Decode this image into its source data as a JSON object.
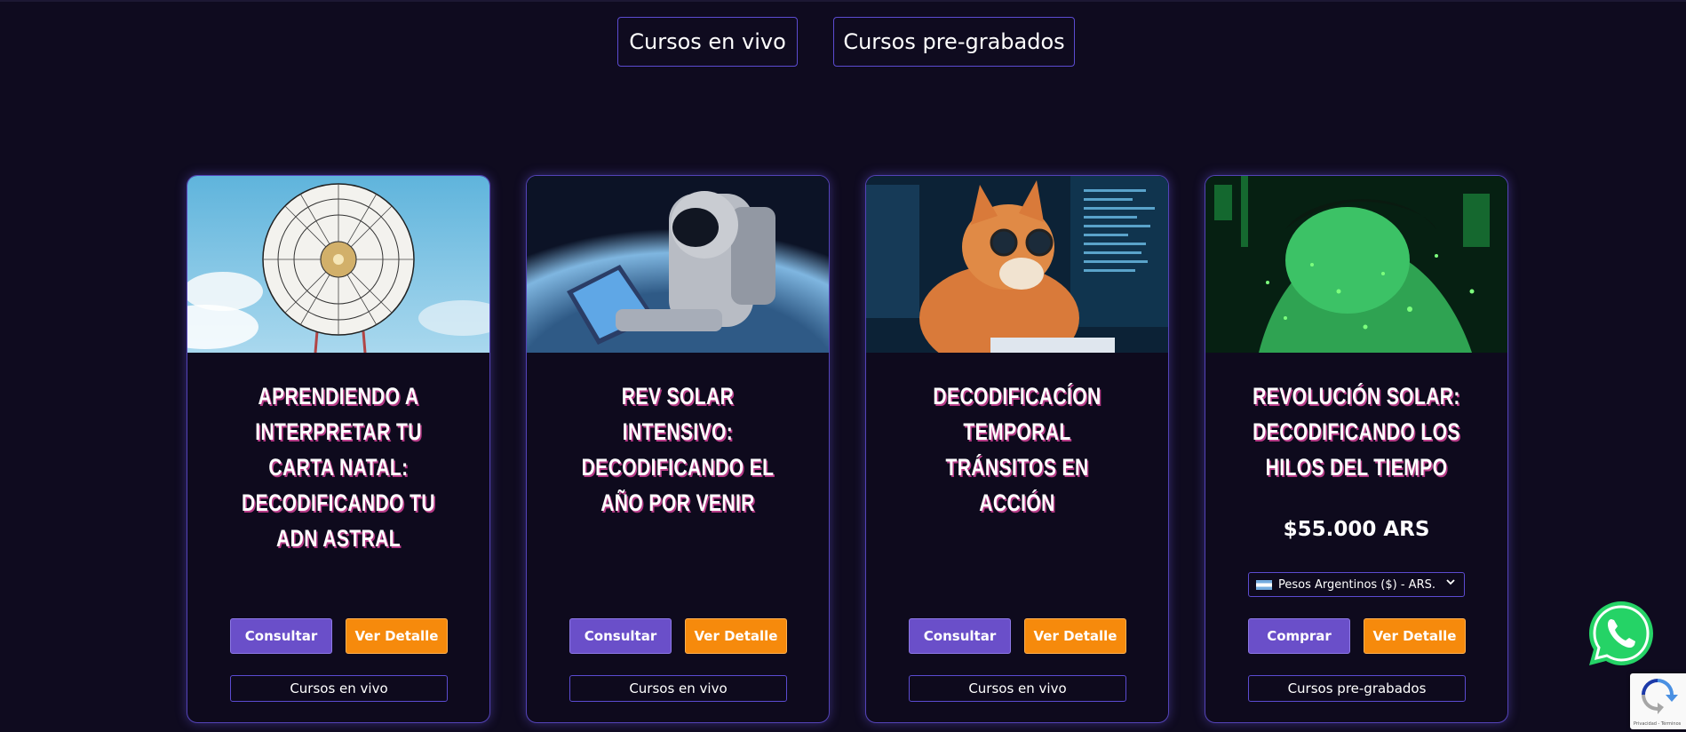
{
  "tabs": [
    {
      "label": "Cursos en vivo"
    },
    {
      "label": "Cursos pre-grabados"
    }
  ],
  "cards": [
    {
      "title": "APRENDIENDO A INTERPRETAR TU CARTA NATAL: DECODIFICANDO TU ADN ASTRAL",
      "image": "zodiac-wheel-sky",
      "primary_label": "Consultar",
      "secondary_label": "Ver Detalle",
      "category": "Cursos en vivo"
    },
    {
      "title": "REV SOLAR INTENSIVO: DECODIFICANDO EL AÑO POR VENIR",
      "image": "astronaut-laptop-space",
      "primary_label": "Consultar",
      "secondary_label": "Ver Detalle",
      "category": "Cursos en vivo"
    },
    {
      "title": "DECODIFICACÍON TEMPORAL TRÁNSITOS EN ACCIÓN",
      "image": "cat-glasses-computer",
      "primary_label": "Consultar",
      "secondary_label": "Ver Detalle",
      "category": "Cursos en vivo"
    },
    {
      "title": "REVOLUCIÓN SOLAR: DECODIFICANDO LOS HILOS DEL TIEMPO",
      "image": "woman-green-matrix",
      "price": "$55.000 ARS",
      "currency_selected": "Pesos Argentinos ($) - ARS.",
      "primary_label": "Comprar",
      "secondary_label": "Ver Detalle",
      "category": "Cursos pre-grabados"
    }
  ],
  "whatsapp": {
    "icon": "whatsapp-icon"
  },
  "recaptcha": {
    "text": "Privacidad - Términos"
  },
  "colors": {
    "background": "#0f0b1f",
    "accent_purple": "#6a4fc9",
    "accent_orange": "#f68a0c",
    "border": "#5b4bd0",
    "whatsapp": "#25d366"
  }
}
